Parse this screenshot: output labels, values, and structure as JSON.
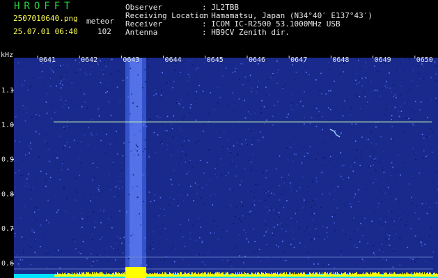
{
  "app": {
    "title": "HROFFT"
  },
  "file": {
    "name": "2507010640.png",
    "datetime": "25.07.01 06:40"
  },
  "meteor": {
    "label": "meteor",
    "count": "102"
  },
  "info": [
    {
      "label": "Observer",
      "value": ": JL2TBB"
    },
    {
      "label": "Receiving Location",
      "value": ": Hamamatsu, Japan (N34°40′ E137°43′)"
    },
    {
      "label": "Receiver",
      "value": ": ICOM IC-R2500 53.1000MHz USB"
    },
    {
      "label": "Antenna",
      "value": ": HB9CV Zenith dir."
    }
  ],
  "chart_data": {
    "type": "heatmap",
    "ylabel": "kHz",
    "x_ticks": [
      "0641",
      "0642",
      "0643",
      "0644",
      "0645",
      "0646",
      "0647",
      "0648",
      "0649",
      "0650"
    ],
    "y_ticks": [
      "1.1",
      "1.0",
      "0.9",
      "0.8",
      "0.7",
      "0.6"
    ],
    "ylim": [
      0.57,
      1.2
    ],
    "carrier_khz": 0.965,
    "noise_burst_minute": "0643",
    "meteor_echo_minute": "0648",
    "grid": false,
    "colors": {
      "background_noise": "#1a2a8c",
      "burst": "#4b74ff",
      "carrier": "#c8ffb0",
      "level_bar_yellow": "#ffff00",
      "level_bar_cyan": "#00e0ff"
    }
  }
}
